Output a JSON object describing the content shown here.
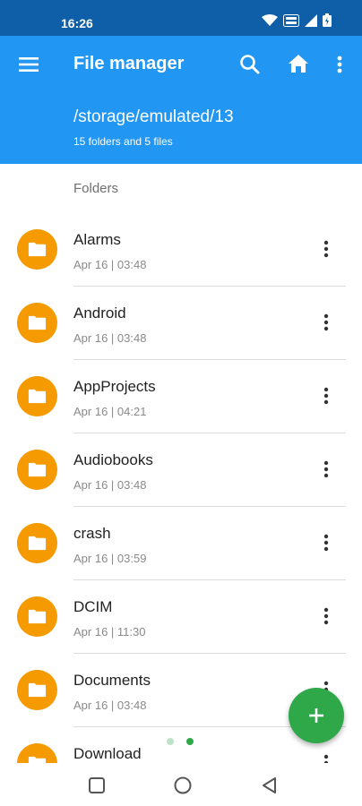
{
  "status_bar": {
    "time": "16:26"
  },
  "app_bar": {
    "title": "File manager",
    "path": "/storage/emulated/13",
    "summary": "15 folders and 5 files"
  },
  "section_header": "Folders",
  "folders": [
    {
      "name": "Alarms",
      "date": "Apr 16 | 03:48"
    },
    {
      "name": "Android",
      "date": "Apr 16 | 03:48"
    },
    {
      "name": "AppProjects",
      "date": "Apr 16 | 04:21"
    },
    {
      "name": "Audiobooks",
      "date": "Apr 16 | 03:48"
    },
    {
      "name": "crash",
      "date": "Apr 16 | 03:59"
    },
    {
      "name": "DCIM",
      "date": "Apr 16 | 11:30"
    },
    {
      "name": "Documents",
      "date": "Apr 16 | 03:48"
    },
    {
      "name": "Download",
      "date": ""
    }
  ],
  "pager": {
    "active_index": 1
  },
  "colors": {
    "status_bar": "#0e5ea8",
    "app_bar": "#2196f3",
    "folder_icon": "#f59a00",
    "fab": "#2fa84a"
  },
  "icons": {
    "menu": "menu-icon",
    "search": "search-icon",
    "home": "home-icon",
    "more": "more-vert-icon",
    "folder": "folder-icon",
    "add": "plus-icon"
  }
}
